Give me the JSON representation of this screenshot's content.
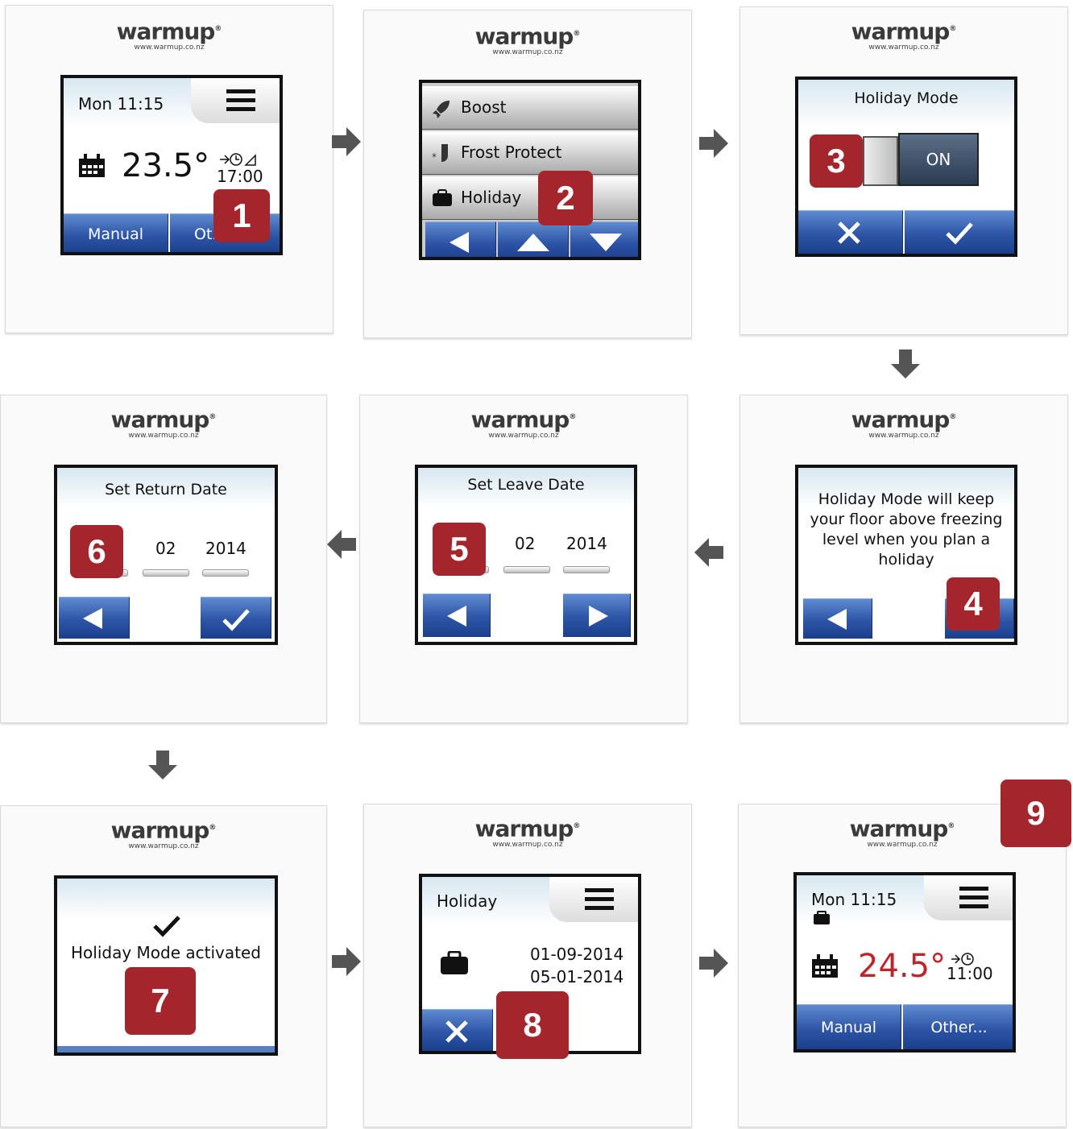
{
  "brand": {
    "name": "warmup",
    "url": "www.warmup.co.nz"
  },
  "step1": {
    "day_time": "Mon 11:15",
    "temperature": "23.5°",
    "next_time": "17:00",
    "btn_manual": "Manual",
    "btn_other": "Oth",
    "badge": "1"
  },
  "step2": {
    "items": [
      "Boost",
      "Frost Protect",
      "Holiday"
    ],
    "badge": "2"
  },
  "step3": {
    "title": "Holiday Mode",
    "toggle": "ON",
    "badge": "3"
  },
  "step4": {
    "text_lines": [
      "Holiday Mode will keep",
      "your floor above freezing",
      "level when you plan a",
      "holiday"
    ],
    "badge": "4"
  },
  "step5": {
    "title": "Set Leave Date",
    "month": "02",
    "year": "2014",
    "badge": "5"
  },
  "step6": {
    "title": "Set Return Date",
    "month": "02",
    "year": "2014",
    "badge": "6"
  },
  "step7": {
    "text": "Holiday Mode activated",
    "badge": "7"
  },
  "step8": {
    "title": "Holiday",
    "date_from": "01-09-2014",
    "date_to": "05-01-2014",
    "badge": "8"
  },
  "step9": {
    "day_time": "Mon 11:15",
    "temperature": "24.5°",
    "next_time": "11:00",
    "btn_manual": "Manual",
    "btn_other": "Other...",
    "badge": "9"
  },
  "colors": {
    "badge": "#a4252c",
    "button_blue": "#2d54a6",
    "arrow": "#555555",
    "temp_red": "#c0242b"
  }
}
